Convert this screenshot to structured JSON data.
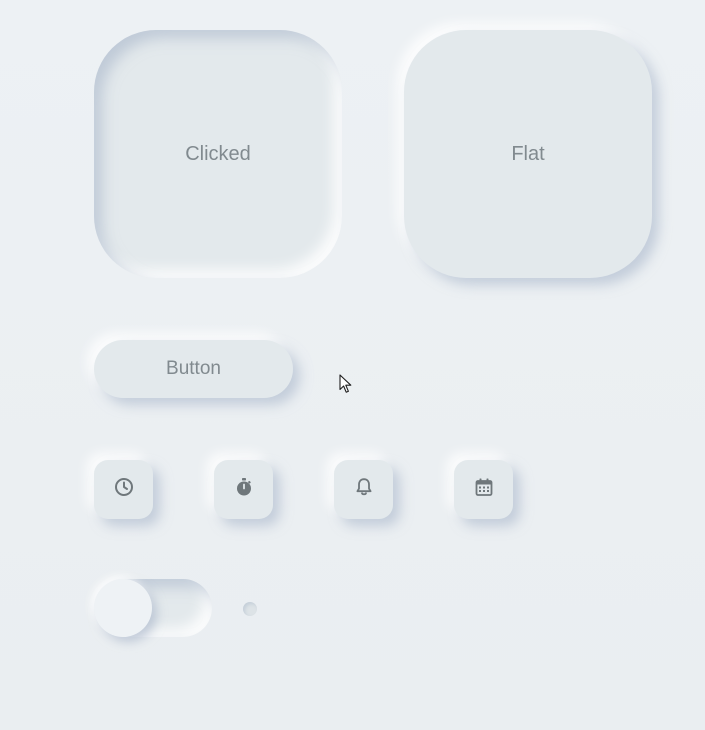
{
  "cards": {
    "clicked_label": "Clicked",
    "flat_label": "Flat"
  },
  "button": {
    "label": "Button"
  },
  "icon_buttons": [
    {
      "icon": "clock-icon"
    },
    {
      "icon": "stopwatch-icon"
    },
    {
      "icon": "bell-icon"
    },
    {
      "icon": "calendar-icon"
    }
  ],
  "toggle": {
    "state": "off"
  },
  "colors": {
    "background": "#ecf0f3",
    "surface": "#e3e9ec",
    "text": "#818a8f",
    "icon": "#6f777b"
  }
}
